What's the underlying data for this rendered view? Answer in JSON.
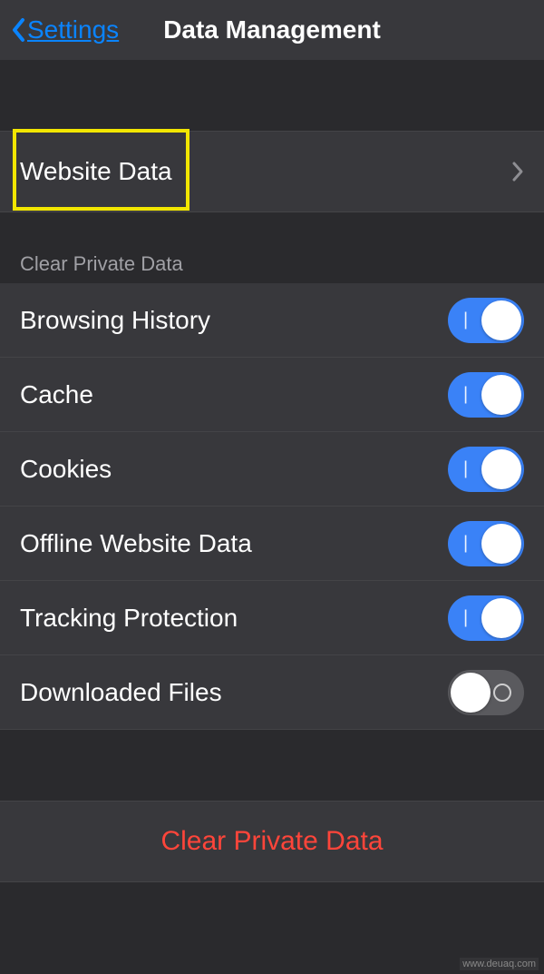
{
  "header": {
    "back_label": "Settings",
    "title": "Data Management"
  },
  "website_data": {
    "label": "Website Data"
  },
  "clear_section": {
    "header": "Clear Private Data",
    "items": [
      {
        "label": "Browsing History",
        "on": true
      },
      {
        "label": "Cache",
        "on": true
      },
      {
        "label": "Cookies",
        "on": true
      },
      {
        "label": "Offline Website Data",
        "on": true
      },
      {
        "label": "Tracking Protection",
        "on": true
      },
      {
        "label": "Downloaded Files",
        "on": false
      }
    ]
  },
  "clear_button": {
    "label": "Clear Private Data"
  },
  "watermark": "www.deuaq.com"
}
